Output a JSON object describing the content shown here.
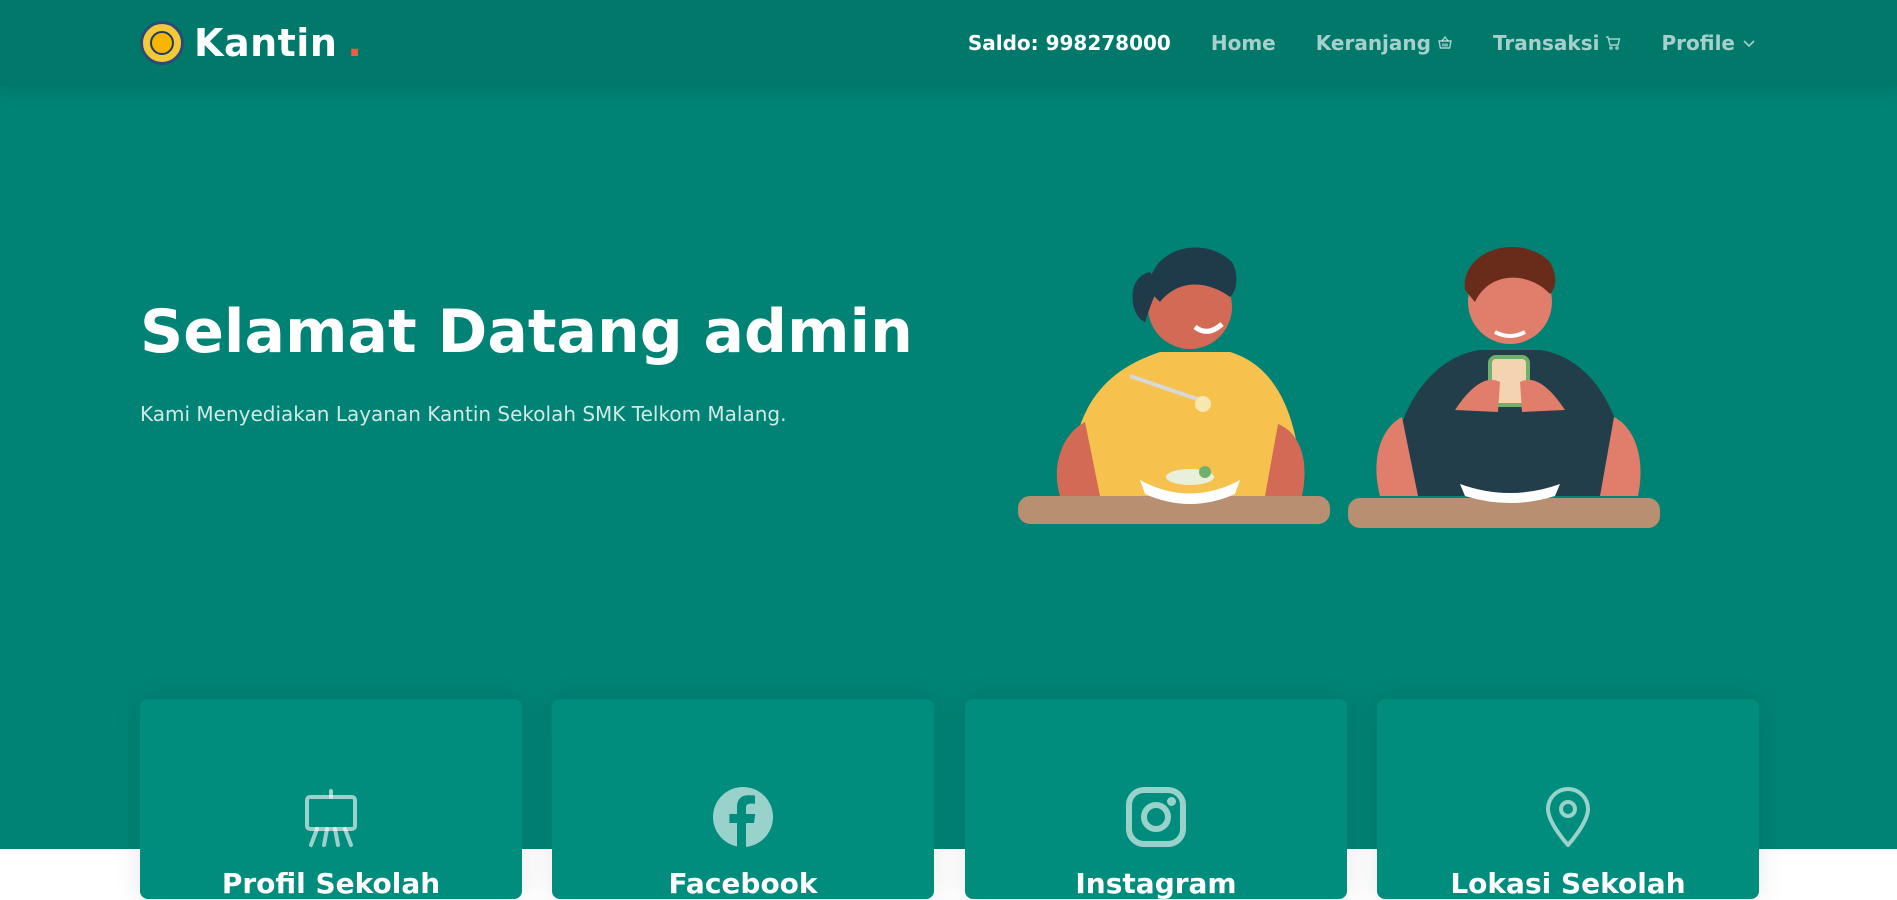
{
  "brand": {
    "name": "Kantin",
    "dot": "."
  },
  "nav": {
    "saldo": "Saldo: 998278000",
    "home": "Home",
    "keranjang": "Keranjang",
    "transaksi": "Transaksi",
    "profile": "Profile"
  },
  "hero": {
    "title": "Selamat Datang admin",
    "subtitle": "Kami Menyediakan Layanan Kantin Sekolah SMK Telkom Malang."
  },
  "cards": [
    {
      "title": "Profil Sekolah",
      "icon": "easel-icon"
    },
    {
      "title": "Facebook",
      "icon": "facebook-icon"
    },
    {
      "title": "Instagram",
      "icon": "instagram-icon"
    },
    {
      "title": "Lokasi Sekolah",
      "icon": "location-pin-icon"
    }
  ],
  "colors": {
    "hero_bg": "#008374",
    "navbar_bg": "#00796b",
    "card_bg": "#008d7d",
    "brand_dot": "#f85a40"
  }
}
